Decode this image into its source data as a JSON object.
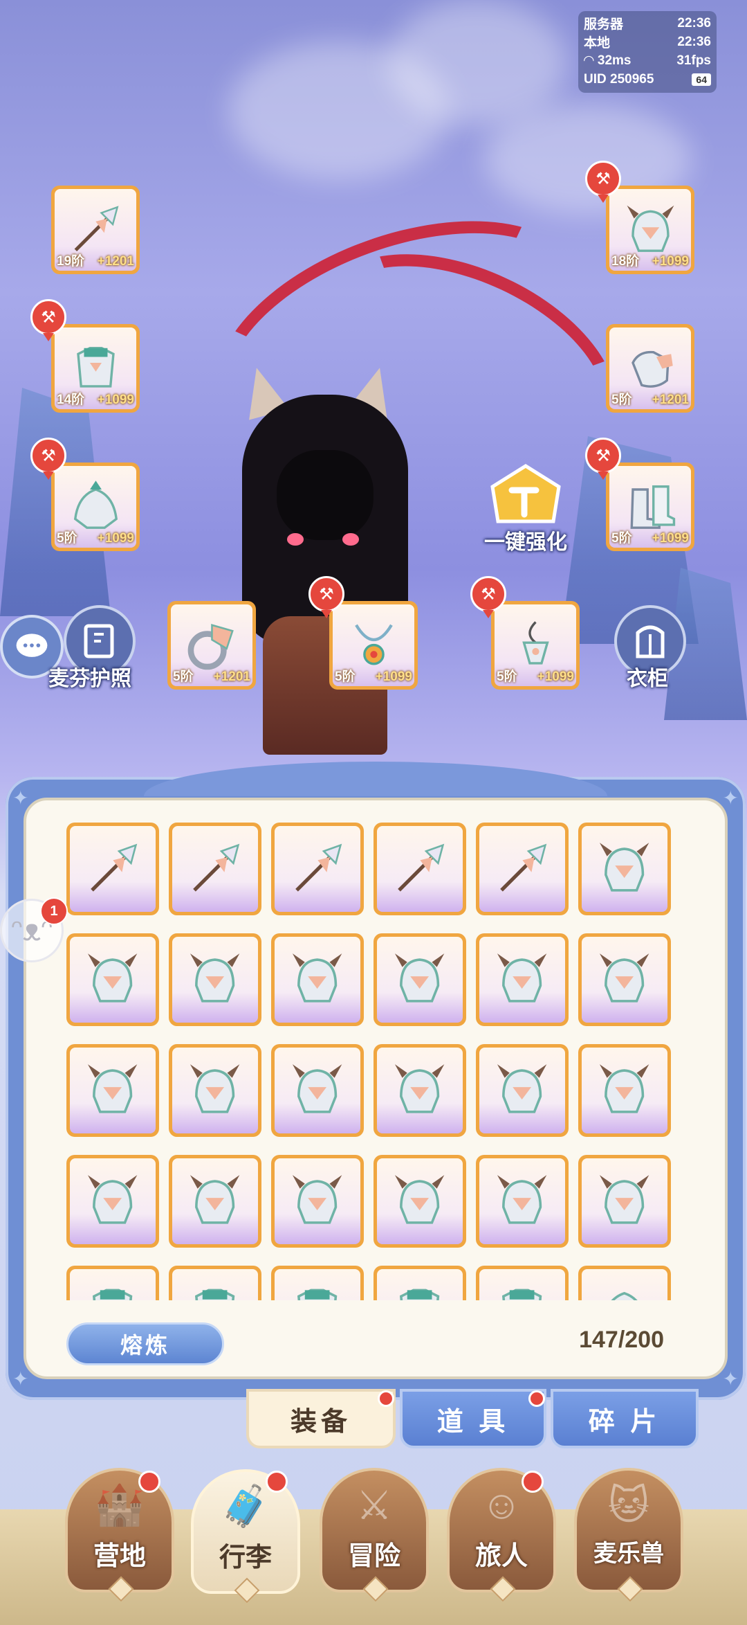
{
  "status": {
    "server_label": "服务器",
    "server_time": "22:36",
    "local_label": "本地",
    "local_time": "22:36",
    "ping": "32ms",
    "fps": "31fps",
    "uid": "UID 250965",
    "battery": "64"
  },
  "equipment_slots": [
    {
      "id": "weapon",
      "level": "19阶",
      "power": "+1201",
      "upgradable": false
    },
    {
      "id": "helmet",
      "level": "18阶",
      "power": "+1099",
      "upgradable": true
    },
    {
      "id": "armor",
      "level": "14阶",
      "power": "+1099",
      "upgradable": true
    },
    {
      "id": "gloves",
      "level": "5阶",
      "power": "+1201",
      "upgradable": false
    },
    {
      "id": "shoulder",
      "level": "5阶",
      "power": "+1099",
      "upgradable": true
    },
    {
      "id": "boots",
      "level": "5阶",
      "power": "+1099",
      "upgradable": true
    },
    {
      "id": "ring",
      "level": "5阶",
      "power": "+1201",
      "upgradable": false
    },
    {
      "id": "necklace",
      "level": "5阶",
      "power": "+1099",
      "upgradable": true
    },
    {
      "id": "charm",
      "level": "5阶",
      "power": "+1099",
      "upgradable": true
    }
  ],
  "actions": {
    "one_click_upgrade": "一键强化",
    "passport": "麦芬护照",
    "wardrobe": "衣柜"
  },
  "inventory": {
    "pet_badge": "1",
    "smelt_label": "熔炼",
    "capacity": "147/200"
  },
  "tabs": [
    {
      "label": "装备",
      "active": true
    },
    {
      "label": "道 具",
      "active": false
    },
    {
      "label": "碎 片",
      "active": false
    }
  ],
  "nav": [
    {
      "label": "营地",
      "icon": "castle-icon",
      "badge": true
    },
    {
      "label": "行李",
      "icon": "bag-icon",
      "badge": true,
      "active": true
    },
    {
      "label": "冒险",
      "icon": "crossed-swords-icon",
      "badge": false
    },
    {
      "label": "旅人",
      "icon": "traveler-icon",
      "badge": true
    },
    {
      "label": "麦乐兽",
      "icon": "pet-cat-icon",
      "badge": false
    }
  ],
  "colors": {
    "accent_orange": "#f0a640",
    "badge_red": "#e5473d",
    "tab_blue": "#5a80d2",
    "panel_paper": "#fbf8ef"
  }
}
